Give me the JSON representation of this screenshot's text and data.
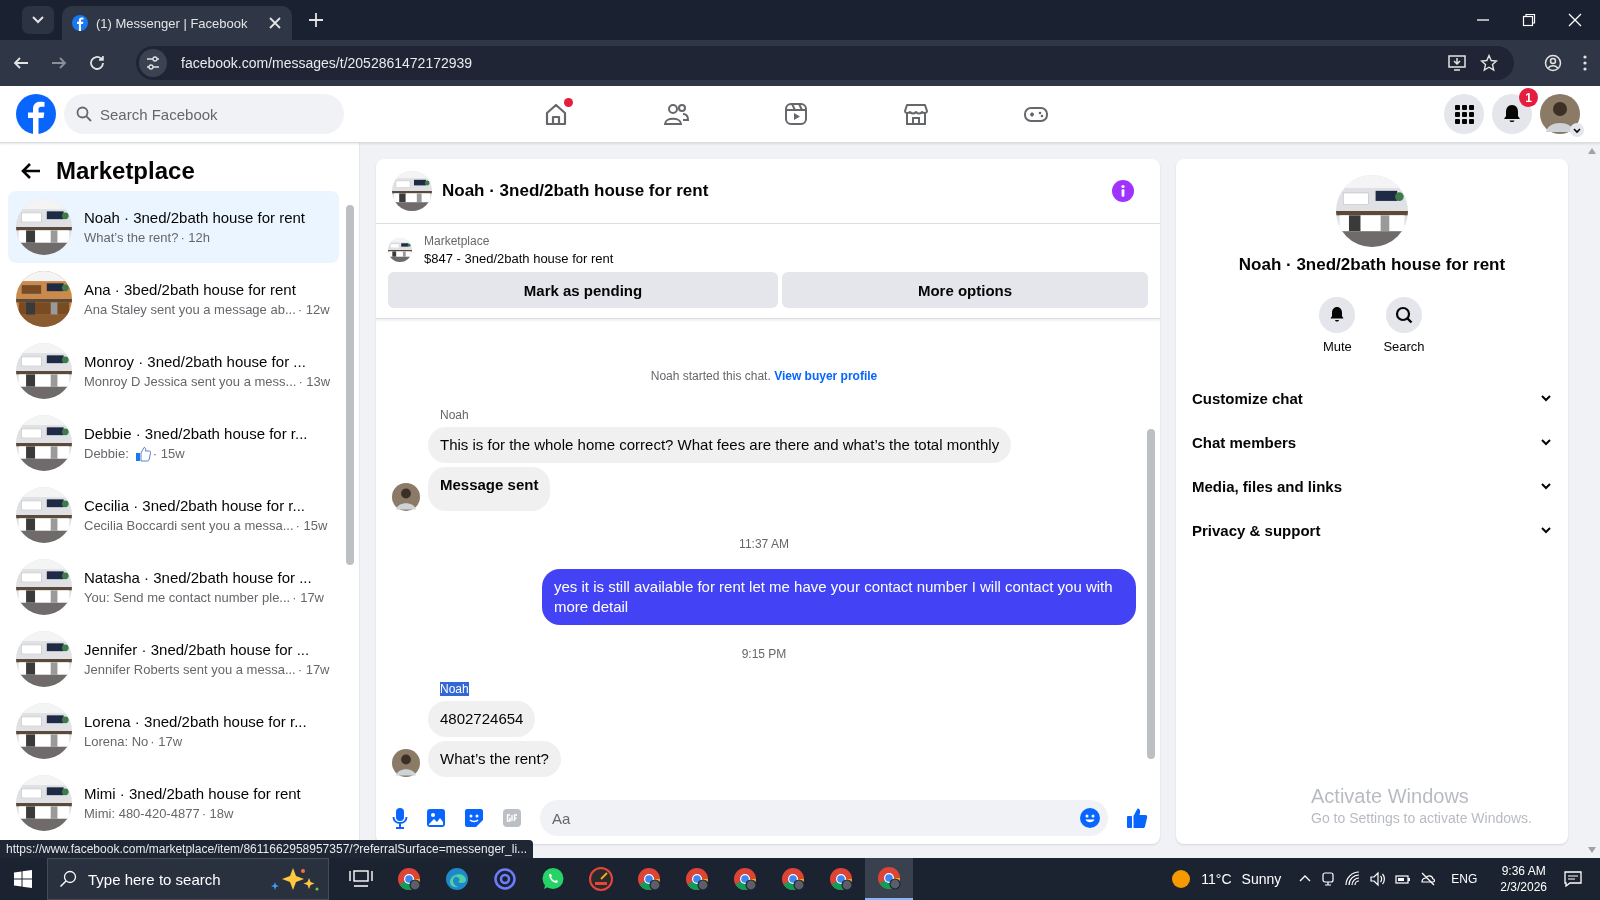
{
  "browser": {
    "tabs": [
      {
        "title": "(1) Messenger | Facebook",
        "selected": true
      }
    ],
    "address": "facebook.com/messages/t/2052861472172939"
  },
  "header": {
    "search": {
      "placeholder": "Search Facebook"
    },
    "nav": [
      {
        "kind": "home",
        "selected": false,
        "dot": true
      },
      {
        "kind": "friends",
        "selected": false,
        "dot": false
      },
      {
        "kind": "video",
        "selected": false,
        "dot": false
      },
      {
        "kind": "marketplace",
        "selected": false,
        "dot": false
      },
      {
        "kind": "gaming",
        "selected": false,
        "dot": false
      }
    ],
    "notifications_badge": "1"
  },
  "sidebar": {
    "title": "Marketplace",
    "conversations": [
      {
        "title": "Noah · 3ned/2bath house for rent",
        "preview": "What’s the rent?",
        "time": "· 12h",
        "selected": true,
        "like": false
      },
      {
        "title": "Ana · 3bed/2bath house for rent",
        "preview": "Ana Staley sent you a message ab...",
        "time": "· 12w",
        "selected": false,
        "like": false
      },
      {
        "title": "Monroy · 3ned/2bath house for ...",
        "preview": "Monroy D Jessica sent you a mess...",
        "time": "· 13w",
        "selected": false,
        "like": false
      },
      {
        "title": "Debbie · 3ned/2bath house for r...",
        "preview": "Debbie:",
        "time": "· 15w",
        "selected": false,
        "like": true
      },
      {
        "title": "Cecilia · 3ned/2bath house for r...",
        "preview": "Cecilia Boccardi sent you a messa...",
        "time": "· 15w",
        "selected": false,
        "like": false
      },
      {
        "title": "Natasha · 3ned/2bath house for ...",
        "preview": "You: Send me contact number ple...",
        "time": "· 17w",
        "selected": false,
        "like": false
      },
      {
        "title": "Jennifer · 3ned/2bath house for ...",
        "preview": "Jennifer Roberts sent you a messa...",
        "time": "· 17w",
        "selected": false,
        "like": false
      },
      {
        "title": "Lorena · 3ned/2bath house for r...",
        "preview": "Lorena: No",
        "time": "· 17w",
        "selected": false,
        "like": false
      },
      {
        "title": "Mimi · 3ned/2bath house for rent",
        "preview": "Mimi: 480-420-4877",
        "time": "· 18w",
        "selected": false,
        "like": false
      }
    ]
  },
  "chat": {
    "title": "Noah · 3ned/2bath house for rent",
    "listing": {
      "label": "Marketplace",
      "item": "$847 - 3ned/2bath house for rent",
      "buttons": [
        "Mark as pending",
        "More options"
      ]
    },
    "messages": [
      {
        "kind": "system",
        "text": "Noah started this chat.",
        "link": "View buyer profile"
      },
      {
        "kind": "sender",
        "text": "Noah",
        "highlighted": false
      },
      {
        "kind": "incoming",
        "text": "This is for the whole home correct? What fees are there and what’s the total monthly",
        "bold": false,
        "avatar": false
      },
      {
        "kind": "incoming",
        "text": "Message sent",
        "bold": true,
        "avatar": true
      },
      {
        "kind": "time",
        "text": "11:37 AM"
      },
      {
        "kind": "outgoing",
        "text": "yes it is still available for rent let me have your contact number I will contact you with more detail"
      },
      {
        "kind": "time",
        "text": "9:15 PM"
      },
      {
        "kind": "sender",
        "text": "Noah",
        "highlighted": true
      },
      {
        "kind": "incoming",
        "text": "4802724654",
        "bold": false,
        "avatar": false
      },
      {
        "kind": "incoming",
        "text": "What’s the rent?",
        "bold": false,
        "avatar": true
      }
    ],
    "composer": {
      "placeholder": "Aa"
    }
  },
  "details": {
    "title": "Noah · 3ned/2bath house for rent",
    "actions": [
      {
        "kind": "mute",
        "label": "Mute"
      },
      {
        "kind": "search",
        "label": "Search"
      }
    ],
    "sections": [
      {
        "label": "Customize chat",
        "expanded": false
      },
      {
        "label": "Chat members",
        "expanded": false
      },
      {
        "label": "Media, files and links",
        "expanded": false
      },
      {
        "label": "Privacy & support",
        "expanded": false
      }
    ]
  },
  "activation": {
    "title": "Activate Windows",
    "text": "Go to Settings to activate Windows."
  },
  "link_preview": "https://www.facebook.com/marketplace/item/8611662958957357/?referralSurface=messenger_li...",
  "taskbar": {
    "search": {
      "placeholder": "Type here to search"
    },
    "apps": [
      {
        "kind": "tasks",
        "active": false
      },
      {
        "kind": "chrome",
        "active": false
      },
      {
        "kind": "edge",
        "active": false
      },
      {
        "kind": "ring",
        "active": false
      },
      {
        "kind": "whatsapp",
        "active": false
      },
      {
        "kind": "meter",
        "active": false
      },
      {
        "kind": "chrome",
        "active": false
      },
      {
        "kind": "chrome",
        "active": false
      },
      {
        "kind": "chrome",
        "active": false
      },
      {
        "kind": "chrome",
        "active": false
      },
      {
        "kind": "chrome",
        "active": false
      },
      {
        "kind": "chrome",
        "active": true
      }
    ],
    "weather": {
      "temp": "11°C",
      "condition": "Sunny"
    },
    "language": "ENG",
    "time": "9:36 AM",
    "date": "2/3/2026"
  }
}
